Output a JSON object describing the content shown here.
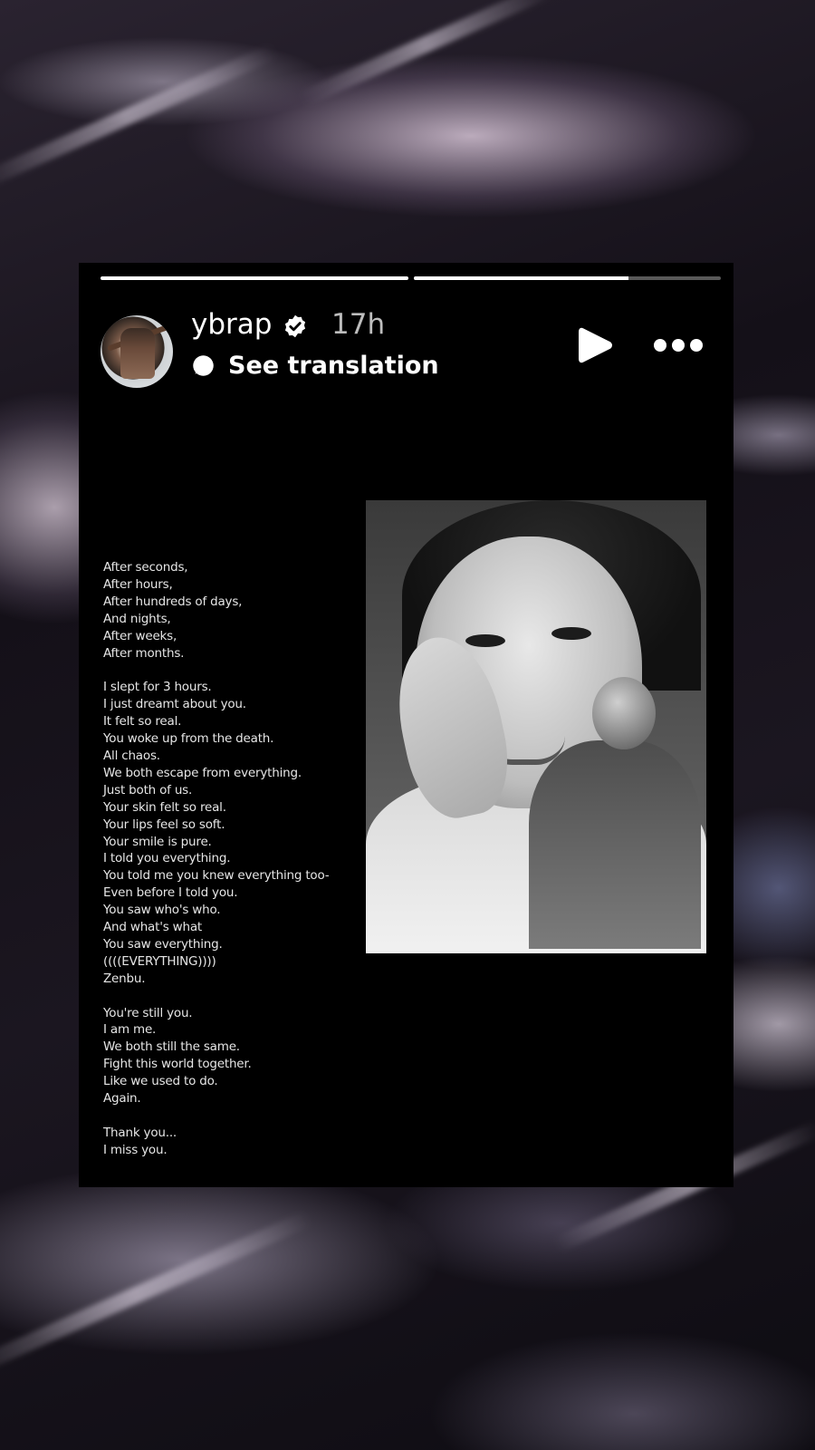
{
  "story": {
    "progress": [
      1.0,
      0.7
    ],
    "user": {
      "username": "ybrap",
      "verified": true,
      "time_ago": "17h"
    },
    "translate_label": "See translation",
    "icons": {
      "verified": "verified-badge-icon",
      "translate": "translate-bubble-icon",
      "play": "play-icon",
      "more": "more-options-icon"
    },
    "poem_text": "After seconds,\nAfter hours,\nAfter  hundreds of days,\nAnd nights,\nAfter weeks,\nAfter months.\n\nI slept for 3 hours.\nI just dreamt about you.\nIt felt so real.\nYou woke up from the death.\nAll chaos.\nWe both escape from everything.\nJust both of us.\nYour skin felt so real.\nYour lips feel so soft.\nYour smile is pure.\nI told you everything.\nYou told me you knew everything too-\nEven before I told you.\nYou saw who's who.\nAnd what's what\nYou saw everything.\n((((EVERYTHING))))\nZenbu.\n\nYou're still you.\nI am me.\nWe both still the same.\nFight this world together.\nLike we used to do.\nAgain.\n\nThank you...\nI miss you."
  }
}
